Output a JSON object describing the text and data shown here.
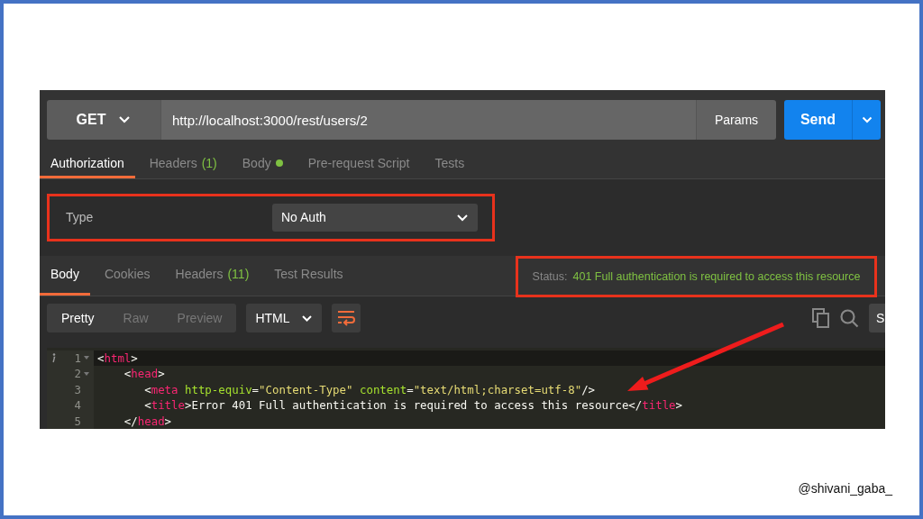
{
  "request": {
    "method": "GET",
    "url": "http://localhost:3000/rest/users/2",
    "params_button": "Params",
    "send_button": "Send"
  },
  "request_tabs": [
    {
      "label": "Authorization",
      "dot": false,
      "selected": true
    },
    {
      "label": "Headers",
      "count": "(1)",
      "dot": false,
      "selected": false
    },
    {
      "label": "Body",
      "dot": true,
      "selected": false
    },
    {
      "label": "Pre-request Script",
      "dot": false,
      "selected": false
    },
    {
      "label": "Tests",
      "dot": false,
      "selected": false
    }
  ],
  "auth": {
    "type_label": "Type",
    "type_value": "No Auth"
  },
  "response_tabs": [
    {
      "label": "Body",
      "selected": true
    },
    {
      "label": "Cookies",
      "selected": false
    },
    {
      "label": "Headers",
      "count": "(11)",
      "selected": false
    },
    {
      "label": "Test Results",
      "selected": false
    }
  ],
  "status": {
    "label": "Status:",
    "text": "401 Full authentication is required to access this resource"
  },
  "view_modes": [
    {
      "label": "Pretty",
      "selected": true
    },
    {
      "label": "Raw",
      "selected": false
    },
    {
      "label": "Preview",
      "selected": false
    }
  ],
  "format": "HTML",
  "line_wrap": {
    "on": true
  },
  "cut_button": "S",
  "code_lines": [
    {
      "number": "1",
      "foldable": true,
      "current": true,
      "tokens": [
        {
          "kind": "punct",
          "text": "<"
        },
        {
          "kind": "tag",
          "text": "html"
        },
        {
          "kind": "punct",
          "text": ">"
        }
      ]
    },
    {
      "number": "2",
      "foldable": true,
      "current": false,
      "tokens": [
        {
          "kind": "punct",
          "text": "    <"
        },
        {
          "kind": "tag",
          "text": "head"
        },
        {
          "kind": "punct",
          "text": ">"
        }
      ]
    },
    {
      "number": "3",
      "foldable": false,
      "current": false,
      "tokens": [
        {
          "kind": "punct",
          "text": "       <"
        },
        {
          "kind": "tag",
          "text": "meta"
        },
        {
          "kind": "attr",
          "text": " http-equiv"
        },
        {
          "kind": "punct",
          "text": "="
        },
        {
          "kind": "string",
          "text": "\"Content-Type\""
        },
        {
          "kind": "attr",
          "text": " content"
        },
        {
          "kind": "punct",
          "text": "="
        },
        {
          "kind": "string",
          "text": "\"text/html;charset=utf-8\""
        },
        {
          "kind": "punct",
          "text": "/>"
        }
      ]
    },
    {
      "number": "4",
      "foldable": false,
      "current": false,
      "tokens": [
        {
          "kind": "punct",
          "text": "       <"
        },
        {
          "kind": "tag",
          "text": "title"
        },
        {
          "kind": "punct",
          "text": ">"
        },
        {
          "kind": "text",
          "text": "Error 401 Full authentication is required to access this resource"
        },
        {
          "kind": "punct",
          "text": "</"
        },
        {
          "kind": "tag",
          "text": "title"
        },
        {
          "kind": "punct",
          "text": ">"
        }
      ]
    },
    {
      "number": "5",
      "foldable": false,
      "current": false,
      "tokens": [
        {
          "kind": "punct",
          "text": "    </"
        },
        {
          "kind": "tag",
          "text": "head"
        },
        {
          "kind": "punct",
          "text": ">"
        }
      ]
    }
  ],
  "credit": "@shivani_gaba_"
}
